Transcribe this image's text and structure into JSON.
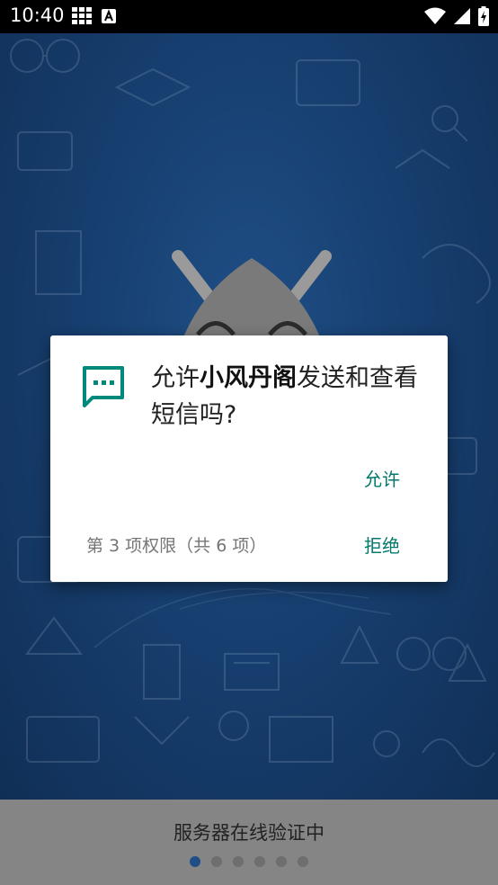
{
  "status_bar": {
    "time": "10:40",
    "left_icons": [
      "grid-icon",
      "font-a-icon"
    ],
    "right_icons": [
      "wifi-icon",
      "signal-icon",
      "battery-icon"
    ]
  },
  "dialog": {
    "icon": "message-icon",
    "title_prefix": "允许",
    "app_name": "小风丹阁",
    "title_suffix": "发送和查看短信吗?",
    "allow_label": "允许",
    "permission_counter": "第 3 项权限（共 6 项）",
    "deny_label": "拒绝"
  },
  "footer": {
    "status_text": "服务器在线验证中",
    "pager": {
      "total": 6,
      "active_index": 0
    }
  },
  "colors": {
    "accent": "#00796b",
    "backdrop": "#173f70",
    "footer": "#858585",
    "active_dot": "#1f4e86"
  }
}
